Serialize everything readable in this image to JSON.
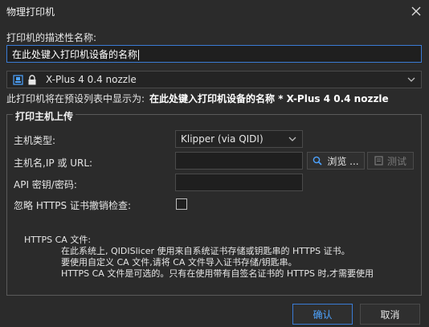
{
  "window": {
    "title": "物理打印机",
    "close_icon": "close-icon"
  },
  "description_label": "打印机的描述性名称:",
  "name_input_value": "在此处键入打印机设备的名称",
  "preset": {
    "name": "X-Plus 4 0.4 nozzle",
    "icons": [
      "printer-preset-icon",
      "lock-icon",
      "chevron-down-icon"
    ]
  },
  "display_line": {
    "prefix": "此打印机将在预设列表中显示为:",
    "value": "在此处键入打印机设备的名称 * X-Plus 4 0.4 nozzle"
  },
  "host_group": {
    "title": "打印主机上传",
    "host_type_label": "主机类型:",
    "host_type_value": "Klipper (via QIDI)",
    "host_url_label": "主机名,IP 或 URL:",
    "browse_label": "浏览 ...",
    "test_label": "测试",
    "api_key_label": "API 密钥/密码:",
    "ignore_https_label": "忽略 HTTPS 证书撤销检查:",
    "ignore_https_checked": false,
    "ca_title": "HTTPS CA 文件:",
    "ca_lines": [
      "在此系统上, QIDISlicer 使用来自系统证书存储或钥匙串的 HTTPS 证书。",
      "要使用自定义 CA 文件,请将 CA 文件导入证书存储/钥匙串。",
      "HTTPS CA 文件是可选的。只有在使用带有自签名证书的 HTTPS 时,才需要使用"
    ]
  },
  "footer": {
    "ok_label": "确认",
    "cancel_label": "取消"
  },
  "colors": {
    "accent": "#3a7bd5",
    "background": "#2b2b2b"
  }
}
